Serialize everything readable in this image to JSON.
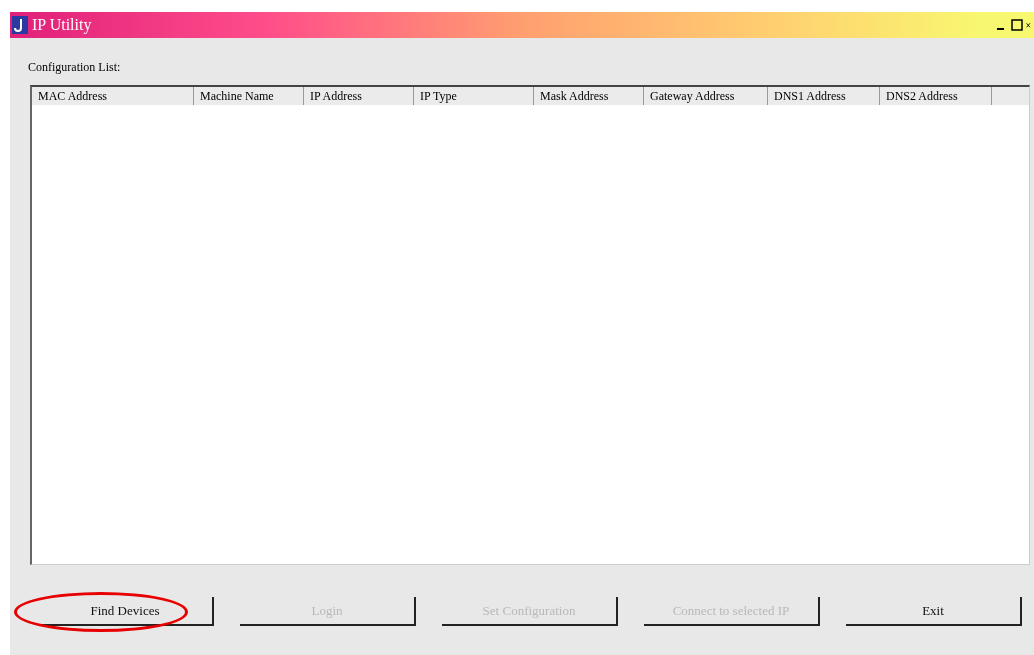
{
  "window": {
    "title": "IP Utility"
  },
  "list_label": "Configuration List:",
  "table": {
    "columns": [
      "MAC Address",
      "Machine Name",
      "IP Address",
      "IP Type",
      "Mask Address",
      "Gateway Address",
      "DNS1 Address",
      "DNS2 Address"
    ]
  },
  "buttons": [
    {
      "label": "Find Devices",
      "disabled": false,
      "highlighted": true
    },
    {
      "label": "Login",
      "disabled": true,
      "highlighted": false
    },
    {
      "label": "Set Configuration",
      "disabled": true,
      "highlighted": false
    },
    {
      "label": "Connect to selected IP",
      "disabled": true,
      "highlighted": false
    },
    {
      "label": "Exit",
      "disabled": false,
      "highlighted": false
    }
  ]
}
